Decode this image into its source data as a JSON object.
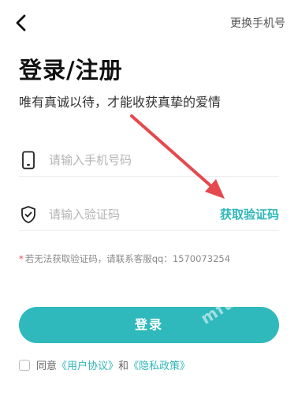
{
  "header": {
    "back_icon": "chevron-left-icon",
    "switch_phone_label": "更换手机号"
  },
  "title": "登录/注册",
  "subtitle": "唯有真诚以待，才能收获真挚的爱情",
  "phone_field": {
    "icon": "phone-icon",
    "placeholder": "请输入手机号码",
    "value": ""
  },
  "code_field": {
    "icon": "shield-check-icon",
    "placeholder": "请输入验证码",
    "value": "",
    "get_code_label": "获取验证码"
  },
  "hint": {
    "asterisk": "*",
    "text": "若无法获取验证码，请联系客服qq：1570073254"
  },
  "login_button_label": "登录",
  "agreement": {
    "prefix": "同意",
    "user_agreement": "《用户协议》",
    "and": "和",
    "privacy_policy": "《隐私政策》",
    "checked": false
  },
  "watermark": "mfu 魔趣阁",
  "colors": {
    "accent": "#2fb9bc",
    "annotation_arrow": "#e5484d"
  }
}
